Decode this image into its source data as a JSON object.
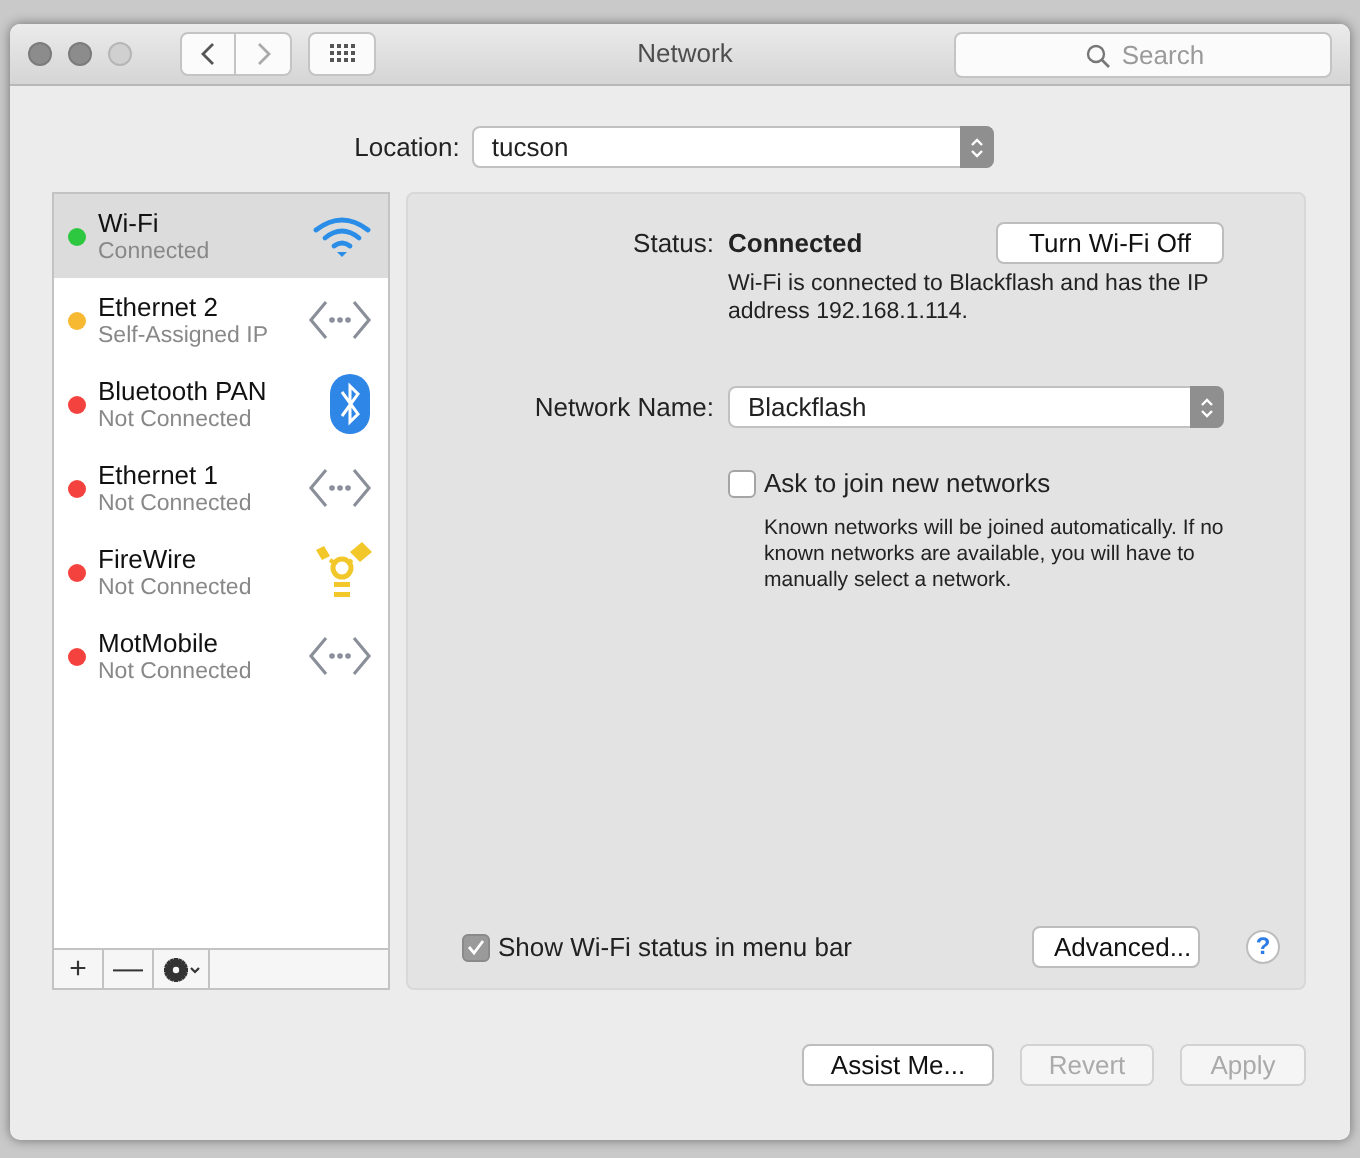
{
  "window": {
    "title": "Network"
  },
  "search": {
    "placeholder": "Search"
  },
  "location": {
    "label": "Location:",
    "value": "tucson"
  },
  "services": [
    {
      "name": "Wi-Fi",
      "status": "Connected",
      "color": "#2ec840",
      "kind": "wifi",
      "selected": true
    },
    {
      "name": "Ethernet 2",
      "status": "Self-Assigned IP",
      "color": "#f8b932",
      "kind": "ethernet",
      "selected": false
    },
    {
      "name": "Bluetooth PAN",
      "status": "Not Connected",
      "color": "#f4433f",
      "kind": "bluetooth",
      "selected": false
    },
    {
      "name": "Ethernet 1",
      "status": "Not Connected",
      "color": "#f4433f",
      "kind": "ethernet",
      "selected": false
    },
    {
      "name": "FireWire",
      "status": "Not Connected",
      "color": "#f4433f",
      "kind": "firewire",
      "selected": false
    },
    {
      "name": "MotMobile",
      "status": "Not Connected",
      "color": "#f4433f",
      "kind": "ethernet",
      "selected": false
    }
  ],
  "list_toolbar": [
    "+",
    "—"
  ],
  "detail": {
    "status_label": "Status:",
    "status_value": "Connected",
    "toggle_button": "Turn Wi-Fi Off",
    "description": "Wi-Fi is connected to Blackflash and has the IP address 192.168.1.114.",
    "network_name_label": "Network Name:",
    "network_name_value": "Blackflash",
    "ask_join": {
      "label": "Ask to join new networks",
      "checked": false
    },
    "ask_join_note": "Known networks will be joined automatically. If no known networks are available, you will have to manually select a network.",
    "show_status": {
      "label": "Show Wi-Fi status in menu bar",
      "checked": true
    },
    "advanced_button": "Advanced...",
    "help_button": "?"
  },
  "buttons": [
    {
      "label": "Assist Me...",
      "disabled": false
    },
    {
      "label": "Revert",
      "disabled": true
    },
    {
      "label": "Apply",
      "disabled": true
    }
  ]
}
